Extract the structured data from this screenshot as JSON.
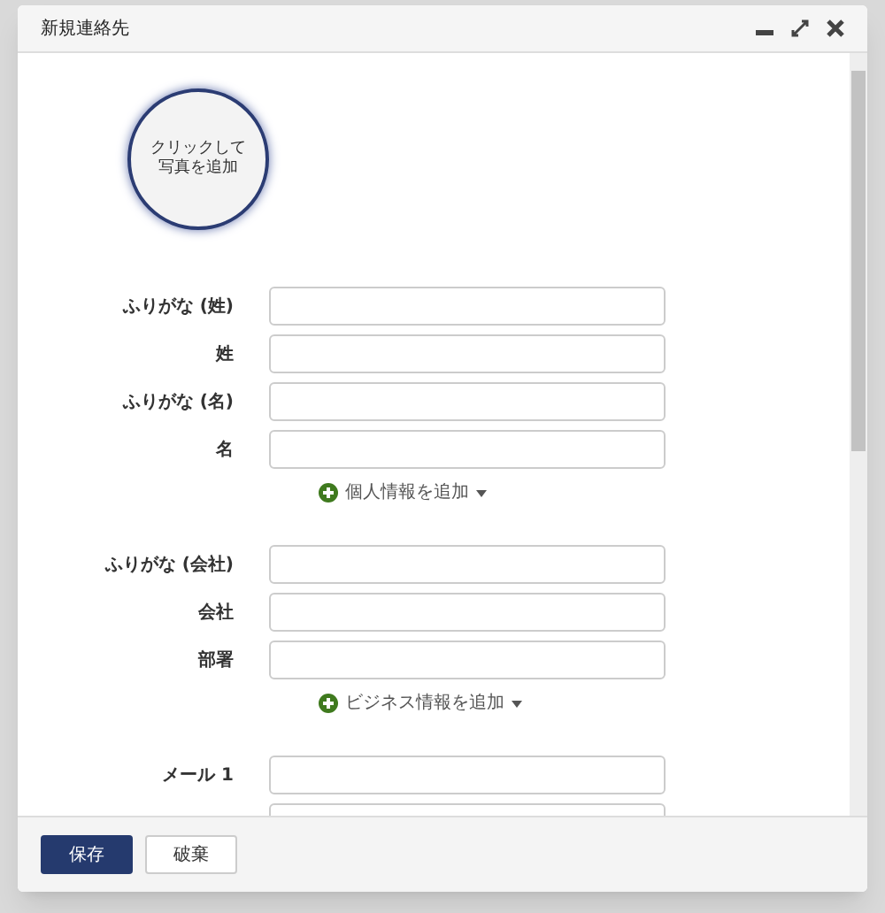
{
  "window": {
    "title": "新規連絡先"
  },
  "photo": {
    "prompt": "クリックして写真を追加"
  },
  "sections": [
    {
      "fields": [
        {
          "label": "ふりがな (姓)"
        },
        {
          "label": "姓"
        },
        {
          "label": "ふりがな (名)"
        },
        {
          "label": "名"
        }
      ],
      "add_link": "個人情報を追加"
    },
    {
      "fields": [
        {
          "label": "ふりがな (会社)"
        },
        {
          "label": "会社"
        },
        {
          "label": "部署"
        }
      ],
      "add_link": "ビジネス情報を追加"
    },
    {
      "fields": [
        {
          "label": "メール 1"
        }
      ]
    }
  ],
  "buttons": [
    {
      "label": "保存",
      "kind": "primary"
    },
    {
      "label": "破棄",
      "kind": "secondary"
    }
  ]
}
